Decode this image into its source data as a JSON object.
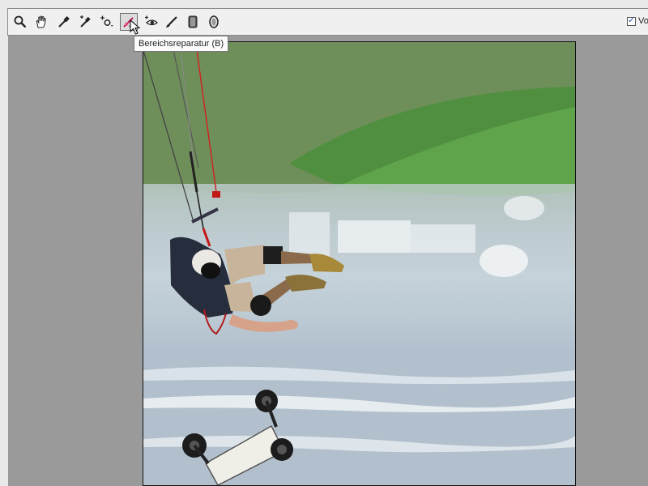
{
  "toolbar": {
    "tools": [
      {
        "name": "zoom-tool",
        "icon": "magnifier-icon"
      },
      {
        "name": "hand-tool",
        "icon": "hand-icon"
      },
      {
        "name": "eyedropper-tool",
        "icon": "eyedropper-icon"
      },
      {
        "name": "white-balance-tool",
        "icon": "eyedropper-plus-icon"
      },
      {
        "name": "crop-tool",
        "icon": "crop-icon"
      },
      {
        "name": "spot-removal-tool",
        "icon": "healing-brush-icon",
        "active": true
      },
      {
        "name": "red-eye-tool",
        "icon": "red-eye-icon"
      },
      {
        "name": "adjustment-brush-tool",
        "icon": "brush-icon"
      },
      {
        "name": "graduated-filter-tool",
        "icon": "graduated-filter-icon"
      },
      {
        "name": "radial-filter-tool",
        "icon": "radial-filter-icon"
      }
    ],
    "preview_label": "Vo",
    "preview_checked": true
  },
  "tooltip": {
    "text": "Bereichsreparatur (B)"
  },
  "colors": {
    "toolbar_bg": "#f0f0f0",
    "canvas_bg": "#9a9a9a"
  }
}
